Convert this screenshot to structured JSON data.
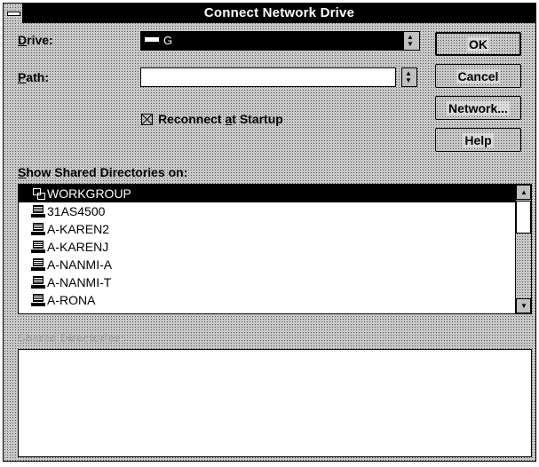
{
  "window": {
    "title": "Connect Network Drive"
  },
  "drive": {
    "label_prefix": "",
    "label_access": "D",
    "label_rest": "rive:",
    "value": "G"
  },
  "path": {
    "label_access": "P",
    "label_rest": "ath:",
    "value": ""
  },
  "reconnect": {
    "label_pre": "Reconnect ",
    "label_access": "a",
    "label_post": "t Startup",
    "checked": true
  },
  "buttons": {
    "ok": "OK",
    "cancel": "Cancel",
    "network": "Network...",
    "help": "Help"
  },
  "shared_on": {
    "label_access": "S",
    "label_rest": "how Shared Directories on:"
  },
  "computers": [
    {
      "name": "WORKGROUP",
      "icon": "workgroup-icon",
      "selected": true
    },
    {
      "name": "31AS4500",
      "icon": "computer-icon",
      "selected": false
    },
    {
      "name": "A-KAREN2",
      "icon": "computer-icon",
      "selected": false
    },
    {
      "name": "A-KARENJ",
      "icon": "computer-icon",
      "selected": false
    },
    {
      "name": "A-NANMI-A",
      "icon": "computer-icon",
      "selected": false
    },
    {
      "name": "A-NANMI-T",
      "icon": "computer-icon",
      "selected": false
    },
    {
      "name": "A-RONA",
      "icon": "computer-icon",
      "selected": false
    }
  ],
  "shared_dirs": {
    "label": "Shared Directories:",
    "items": []
  }
}
